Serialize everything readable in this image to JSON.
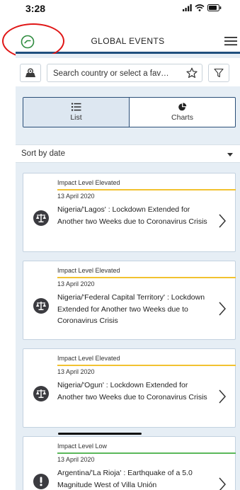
{
  "status_bar": {
    "time": "3:28"
  },
  "header": {
    "title": "GLOBAL EVENTS",
    "accent_color": "#1f4f7e",
    "clock_icon_color": "#2e8b3e",
    "annotation_color": "#e01616"
  },
  "search": {
    "placeholder": "Search country or select a fav…"
  },
  "view_tabs": [
    {
      "label": "List",
      "icon": "list-icon",
      "active": true
    },
    {
      "label": "Charts",
      "icon": "pie-chart-icon",
      "active": false
    }
  ],
  "sort": {
    "label": "Sort by date"
  },
  "events": [
    {
      "impact": "Impact Level Elevated",
      "impact_color": "#f2c230",
      "date": "13 April 2020",
      "title": "Nigeria/'Lagos' : Lockdown Extended for Another two Weeks due to Coronavirus Crisis",
      "icon": "scales-icon"
    },
    {
      "impact": "Impact Level Elevated",
      "impact_color": "#f2c230",
      "date": "13 April 2020",
      "title": "Nigeria/'Federal Capital Territory' : Lockdown Extended for Another two Weeks due to Coronavirus Crisis",
      "icon": "scales-icon"
    },
    {
      "impact": "Impact Level Elevated",
      "impact_color": "#f2c230",
      "date": "13 April 2020",
      "title": "Nigeria/'Ogun' : Lockdown Extended for Another two Weeks due to Coronavirus Crisis",
      "icon": "scales-icon"
    },
    {
      "impact": "Impact Level Low",
      "impact_color": "#5bb85b",
      "date": "13 April 2020",
      "title": "Argentina/'La Rioja' : Earthquake of a 5.0 Magnitude West of Villa Unión",
      "icon": "exclamation-icon"
    }
  ]
}
